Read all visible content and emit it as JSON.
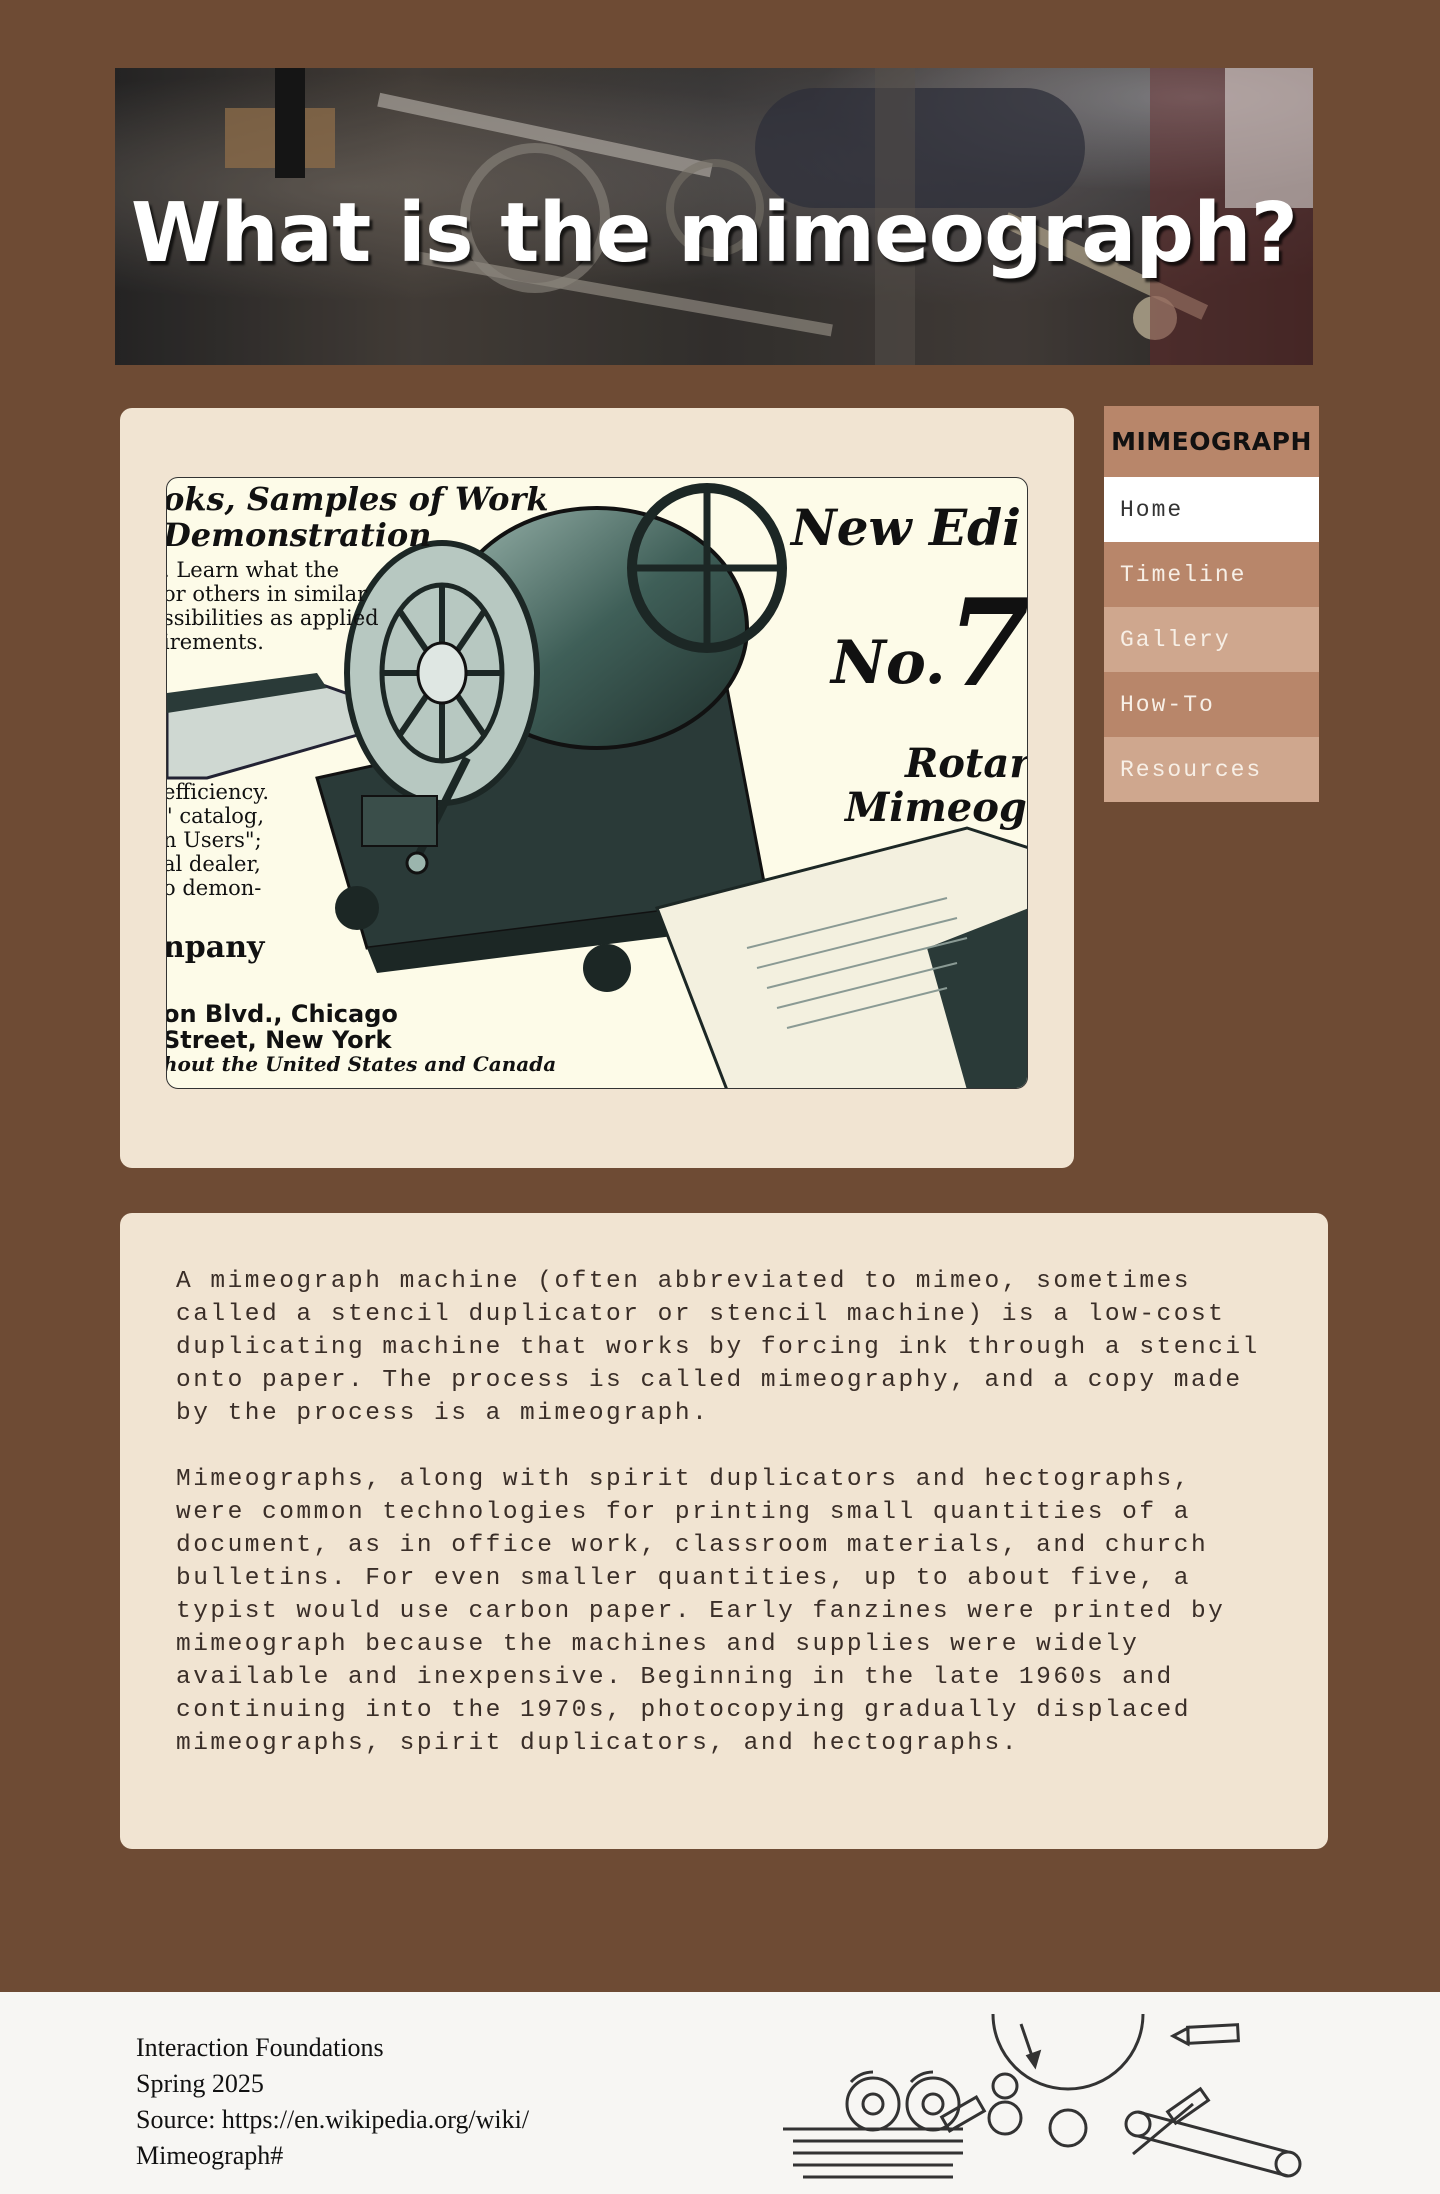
{
  "hero": {
    "title": "What is the mimeograph?"
  },
  "ad_image": {
    "lines": [
      "oks, Samples of Work",
      "Demonstration",
      ". Learn what the",
      "or others in similar",
      "ssibilities as applied",
      "irements.",
      "efficiency.",
      "\" catalog,",
      "n Users\";",
      "al dealer,",
      "o demon-",
      "npany",
      "on Blvd., Chicago",
      "Street, New York",
      "hout the United States and Canada",
      "New Edi",
      "No.",
      "7",
      "Rotar",
      "Mimeogr"
    ]
  },
  "sidebar": {
    "brand": "MIMEOGRAPH",
    "items": [
      {
        "label": "Home"
      },
      {
        "label": "Timeline"
      },
      {
        "label": "Gallery"
      },
      {
        "label": "How-To"
      },
      {
        "label": "Resources"
      }
    ]
  },
  "main": {
    "paragraphs": [
      "A mimeograph machine (often abbreviated to mimeo, sometimes called a stencil duplicator or stencil machine) is a low-cost duplicating machine that works by forcing ink through a stencil onto paper. The process is called mimeography, and a copy made by the process is a mimeograph.",
      "Mimeographs, along with spirit duplicators and hectographs, were common technologies for printing small quantities of a document, as in office work, classroom materials, and church bulletins. For even smaller quantities, up to about five, a typist would use carbon paper. Early fanzines were printed by mimeograph because the machines and supplies were widely available and inexpensive. Beginning in the late 1960s and continuing into the 1970s, photocopying gradually displaced mimeographs, spirit duplicators, and hectographs."
    ]
  },
  "footer": {
    "lines": [
      "Interaction Foundations",
      "Spring 2025",
      "Source: https://en.wikipedia.org/wiki/",
      "Mimeograph#"
    ]
  },
  "colors": {
    "page_background": "#6e4b34",
    "card_background": "#f1e4d2",
    "nav_brand": "#b8866a",
    "nav_dark": "#b8866a",
    "nav_light": "#cfa78e",
    "nav_active": "#ffffff",
    "footer_background": "#f7f6f3"
  }
}
